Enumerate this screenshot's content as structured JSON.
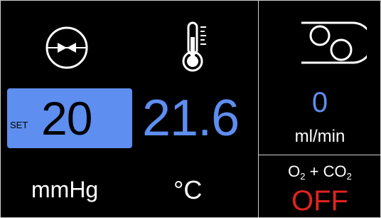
{
  "colors": {
    "accent": "#5e8ef0",
    "alert": "#e0231e",
    "border": "#cfcfcf",
    "background": "#000000"
  },
  "left_panel": {
    "pressure_icon": "valve-icon",
    "temperature_icon": "thermometer-icon",
    "set_label": "SET",
    "pressure_setpoint": "20",
    "temperature_value": "21.6",
    "pressure_unit": "mmHg",
    "temperature_unit": "°C"
  },
  "right_top_panel": {
    "pump_icon": "peristaltic-pump-icon",
    "flow_value": "0",
    "flow_unit": "ml/min"
  },
  "right_bottom_panel": {
    "gas_label_part1": "O",
    "gas_label_sub1": "2",
    "gas_label_plus": " + CO",
    "gas_label_sub2": "2",
    "gas_state": "OFF"
  }
}
